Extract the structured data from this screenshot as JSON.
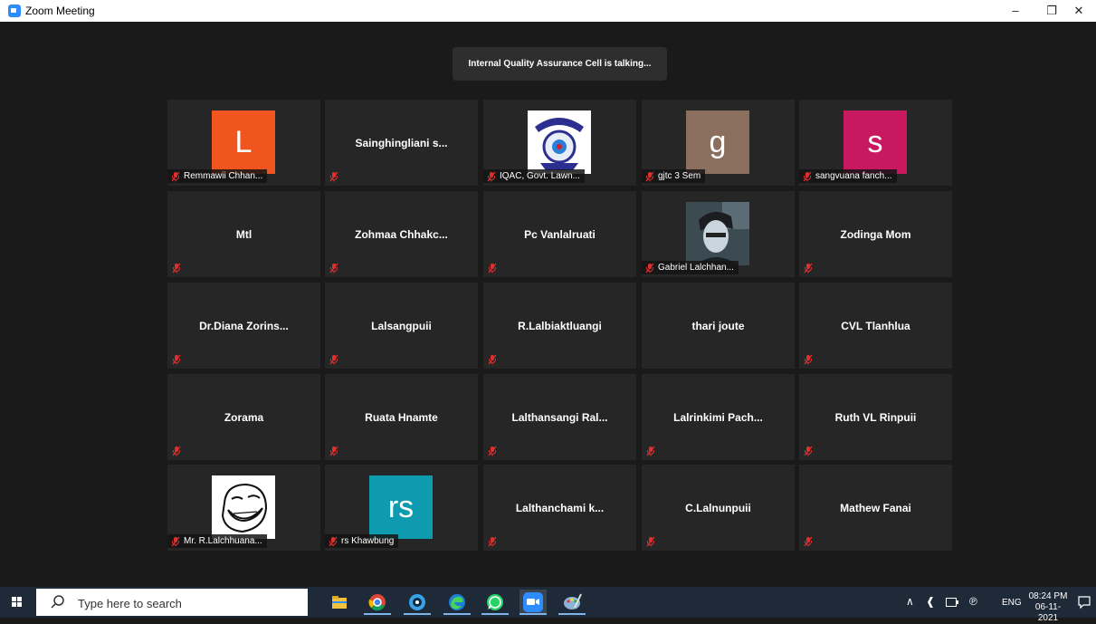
{
  "window": {
    "title": "Zoom Meeting"
  },
  "banner": {
    "text": "Internal Quality Assurance Cell is talking..."
  },
  "colors": {
    "mute": "#e02f2f",
    "tile": "#262626",
    "accent": "#2d8cff"
  },
  "participants": [
    {
      "name": "",
      "label": "Remmawii Chhan...",
      "avatar": "L",
      "avatar_color": "#f0541f"
    },
    {
      "name": "Sainghingliani s...",
      "label": ""
    },
    {
      "name": "",
      "label": "IQAC, Govt. Lawn...",
      "avatar_image": "college-seal"
    },
    {
      "name": "",
      "label": "gjtc 3 Sem",
      "avatar": "g",
      "avatar_color": "#8a6e5e"
    },
    {
      "name": "",
      "label": "sangvuana fanch...",
      "avatar": "s",
      "avatar_color": "#c8185f"
    },
    {
      "name": "Mtl",
      "label": ""
    },
    {
      "name": "Zohmaa Chhakc...",
      "label": ""
    },
    {
      "name": "Pc Vanlalruati",
      "label": ""
    },
    {
      "name": "",
      "label": "Gabriel Lalchhan...",
      "avatar_image": "photo"
    },
    {
      "name": "Zodinga Mom",
      "label": ""
    },
    {
      "name": "Dr.Diana Zorins...",
      "label": ""
    },
    {
      "name": "Lalsangpuii",
      "label": ""
    },
    {
      "name": "R.Lalbiaktluangi",
      "label": ""
    },
    {
      "name": "thari joute",
      "label": "",
      "no_mic": true
    },
    {
      "name": "CVL Tlanhlua",
      "label": ""
    },
    {
      "name": "Zorama",
      "label": ""
    },
    {
      "name": "Ruata Hnamte",
      "label": ""
    },
    {
      "name": "Lalthansangi Ral...",
      "label": ""
    },
    {
      "name": "Lalrinkimi Pach...",
      "label": ""
    },
    {
      "name": "Ruth VL Rinpuii",
      "label": ""
    },
    {
      "name": "",
      "label": "Mr. R.Lalchhuana...",
      "avatar_image": "meme-face"
    },
    {
      "name": "",
      "label": "rs Khawbung",
      "avatar": "rs",
      "avatar_color": "#0e9bb0"
    },
    {
      "name": "Lalthanchami k...",
      "label": ""
    },
    {
      "name": "C.Lalnunpuii",
      "label": ""
    },
    {
      "name": "Mathew Fanai",
      "label": ""
    }
  ],
  "taskbar": {
    "search_placeholder": "Type here to search",
    "apps": [
      "file-explorer-icon",
      "chrome-icon",
      "media-player-icon",
      "edge-icon",
      "whatsapp-icon",
      "zoom-icon",
      "paint-icon"
    ],
    "lang": "ENG",
    "time": "08:24 PM",
    "date": "06-11-2021"
  }
}
